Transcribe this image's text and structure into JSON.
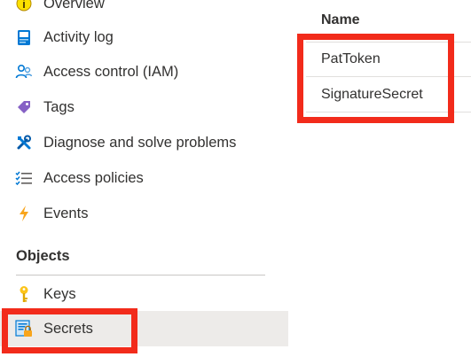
{
  "sidebar": {
    "items": [
      {
        "label": "Overview",
        "icon": "info-icon"
      },
      {
        "label": "Activity log",
        "icon": "activity-log-icon"
      },
      {
        "label": "Access control (IAM)",
        "icon": "people-icon"
      },
      {
        "label": "Tags",
        "icon": "tag-icon"
      },
      {
        "label": "Diagnose and solve problems",
        "icon": "wrench-icon"
      },
      {
        "label": "Access policies",
        "icon": "checklist-icon"
      },
      {
        "label": "Events",
        "icon": "lightning-icon"
      }
    ],
    "objects_header": "Objects",
    "objects_items": [
      {
        "label": "Keys",
        "icon": "key-icon"
      },
      {
        "label": "Secrets",
        "icon": "secret-icon",
        "selected": true
      }
    ]
  },
  "secrets_list": {
    "column_header": "Name",
    "rows": [
      {
        "name": "PatToken"
      },
      {
        "name": "SignatureSecret"
      }
    ]
  },
  "colors": {
    "highlight": "#f22b1b",
    "selected_background": "#edebe9",
    "text": "#323130"
  }
}
